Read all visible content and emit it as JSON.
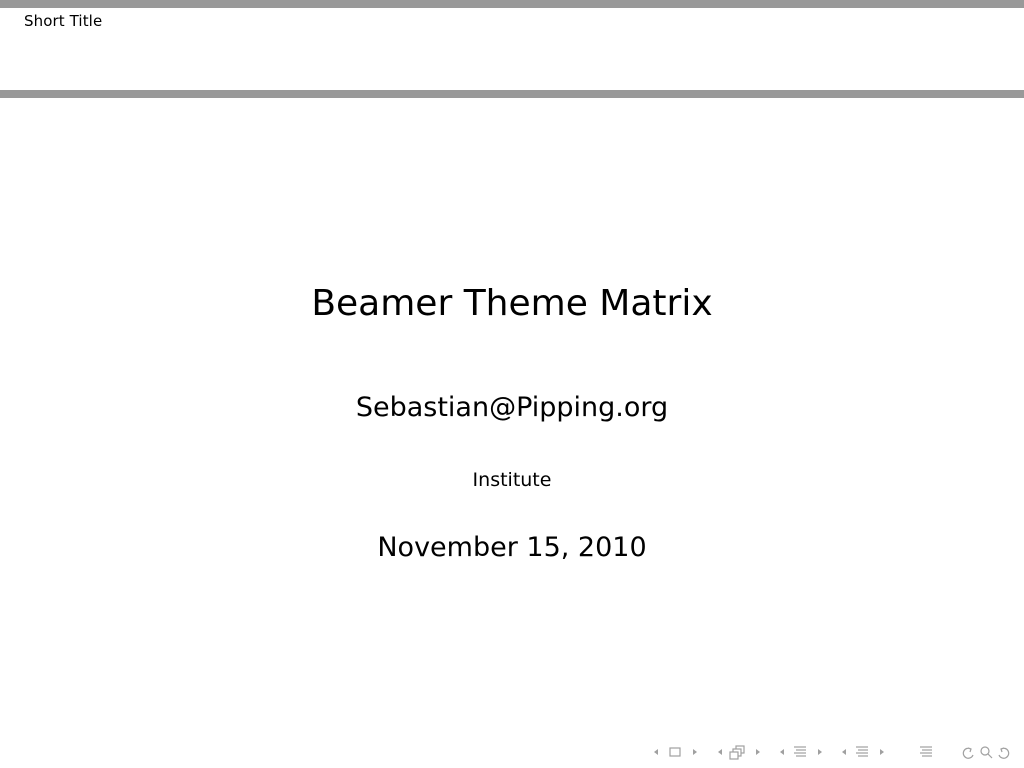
{
  "header": {
    "short_title": "Short Title"
  },
  "slide": {
    "title": "Beamer Theme Matrix",
    "author": "Sebastian@Pipping.org",
    "institute": "Institute",
    "date": "November 15, 2010"
  },
  "navigation": {
    "icon_color": "#a0a0a0",
    "icons": [
      "nav-left-arrow-icon",
      "frame-icon",
      "nav-right-arrow-icon",
      "nav-left-arrow-icon",
      "subsection-icon",
      "nav-right-arrow-icon",
      "nav-left-arrow-icon",
      "section-icon",
      "nav-right-arrow-icon",
      "nav-left-arrow-icon",
      "section-icon",
      "nav-right-arrow-icon",
      "appendix-icon",
      "undo-icon",
      "find-icon",
      "redo-icon"
    ]
  },
  "colors": {
    "rule": "#999999",
    "text": "#000000",
    "background": "#ffffff"
  }
}
